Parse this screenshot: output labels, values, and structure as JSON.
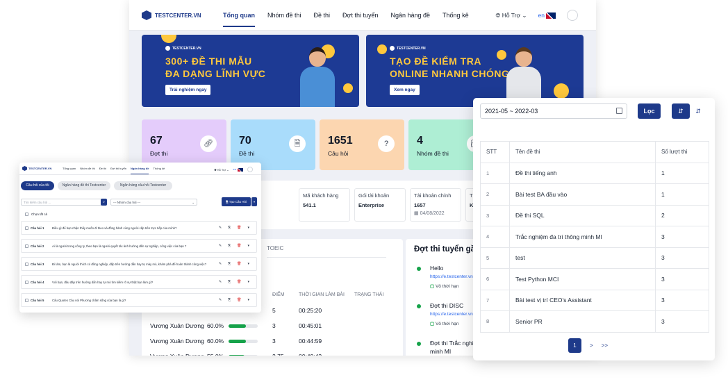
{
  "main": {
    "brand": "TESTCENTER.VN",
    "nav": [
      "Tổng quan",
      "Nhóm đề thi",
      "Đề thi",
      "Đợt thi tuyển",
      "Ngân hàng đề",
      "Thống kê"
    ],
    "support": "Hỗ Trợ",
    "lang": "en",
    "banners": [
      {
        "brand": "TESTCENTER.VN",
        "title1": "300+ ĐỀ THI MẪU",
        "title2": "ĐA DẠNG LĨNH VỰC",
        "button": "Trải nghiệm ngay"
      },
      {
        "brand": "TESTCENTER.VN",
        "title1": "TẠO ĐỀ KIỂM TRA",
        "title2": "ONLINE NHANH CHÓNG",
        "button": "Xem ngay"
      }
    ],
    "stats": [
      {
        "value": "67",
        "label": "Đợt thi",
        "color": "#e4ccfb",
        "icon": "link-icon"
      },
      {
        "value": "70",
        "label": "Đề thi",
        "color": "#a9dcfb",
        "icon": "document-icon"
      },
      {
        "value": "1651",
        "label": "Câu hỏi",
        "color": "#fcd6b0",
        "icon": "question-icon"
      },
      {
        "value": "4",
        "label": "Nhóm đề thi",
        "color": "#aeeed4",
        "icon": "folder-icon"
      }
    ],
    "account": {
      "customer_label": "Mã khách hàng",
      "customer_value": "541.1",
      "plan_label": "Gói tài khoản",
      "plan_value": "Enterprise",
      "main_label": "Tài khoản chính",
      "main_value": "1657",
      "main_date": "04/08/2022",
      "extra_label": "T",
      "extra_value": "K"
    },
    "results": {
      "tab": "TOEIC",
      "headers": {
        "score": "ĐIỂM",
        "time": "THỜI GIAN LÀM BÀI",
        "status": "TRẠNG THÁI"
      },
      "rows": [
        {
          "name": "",
          "pct": "",
          "progress": 0,
          "score": "5",
          "time": "00:25:20"
        },
        {
          "name": "Vương Xuân Dương",
          "pct": "60.0%",
          "progress": 0.6,
          "score": "3",
          "time": "00:45:01"
        },
        {
          "name": "Vương Xuân Dương",
          "pct": "60.0%",
          "progress": 0.6,
          "score": "3",
          "time": "00:44:59"
        },
        {
          "name": "Vương Xuân Dương",
          "pct": "55.0%",
          "progress": 0.55,
          "score": "2.75",
          "time": "00:49:43"
        }
      ]
    },
    "recruit": {
      "title": "Đợt thi tuyển gầ",
      "items": [
        {
          "name": "Hello",
          "url": "https://e.testcenter.vn",
          "limit": "Vô thời hạn"
        },
        {
          "name": "Đợt thi DISC",
          "url": "https://e.testcenter.vn",
          "limit": "Vô thời hạn"
        },
        {
          "name": "Đợt thi Trắc nghi",
          "name2": "minh MI"
        }
      ]
    }
  },
  "questions": {
    "brand": "TESTCENTER.VN",
    "nav": [
      "Tổng quan",
      "Nhóm đề thi",
      "Đề thi",
      "Đợt thi tuyển",
      "Ngân hàng đề",
      "Thống kê"
    ],
    "support": "Hỗ Trợ",
    "lang": "en",
    "tabs": [
      "Câu hỏi của tôi",
      "Ngân hàng đề thi Testcenter",
      "Ngân hàng câu hỏi Testcenter"
    ],
    "search_placeholder": "Tìm kiếm câu hỏi ...",
    "group_select": "--- Nhóm câu hỏi ---",
    "new_button": "Tạo Câu Hỏi",
    "select_all": "Chọn tất cả",
    "items": [
      {
        "id": "Câu hỏi 1",
        "text": "Điều gì để bạn nhận thấy muốn đi theo và đồng hành cùng người cấp trên trực tiếp của mình?"
      },
      {
        "id": "Câu hỏi 2",
        "text": "Ai là người trong công ty, theo bạn là người quyết tác ảnh hưởng đến sự nghiệp, công việc của bạn ?"
      },
      {
        "id": "Câu hỏi 3",
        "text": "Đi làm, bạn là người thích có đồng nghiệp, dắp trên hướng dẫn hay tự mày mò, khám phá để hoàn thành công việc?"
      },
      {
        "id": "Câu hỏi 4",
        "text": "Với bạn, đâu đáp trên hướng dẫn hay tự mò tìm kiếm rõ sự thật bạn làm gì?"
      },
      {
        "id": "Câu hỏi 5",
        "text": "Câu Quotes Câu nói Phương châm sống của bạn là gì?"
      }
    ]
  },
  "stats_window": {
    "date_range": "2021-05 ~ 2022-03",
    "filter_button": "Lọc",
    "headers": [
      "STT",
      "Tên đề thi",
      "Số lượt thi"
    ],
    "rows": [
      {
        "stt": "1",
        "name": "Đề thi tiếng anh",
        "count": "1"
      },
      {
        "stt": "2",
        "name": "Bài test BA đầu vào",
        "count": "1"
      },
      {
        "stt": "3",
        "name": "Đề thi SQL",
        "count": "2"
      },
      {
        "stt": "4",
        "name": "Trắc nghiệm đa trí thông minh MI",
        "count": "3"
      },
      {
        "stt": "5",
        "name": "test",
        "count": "3"
      },
      {
        "stt": "6",
        "name": "Test Python MCI",
        "count": "3"
      },
      {
        "stt": "7",
        "name": "Bài test vị trí CEO's Assistant",
        "count": "3"
      },
      {
        "stt": "8",
        "name": "Senior PR",
        "count": "3"
      }
    ],
    "pager": {
      "current": "1",
      "next": ">",
      "last": ">>"
    }
  }
}
